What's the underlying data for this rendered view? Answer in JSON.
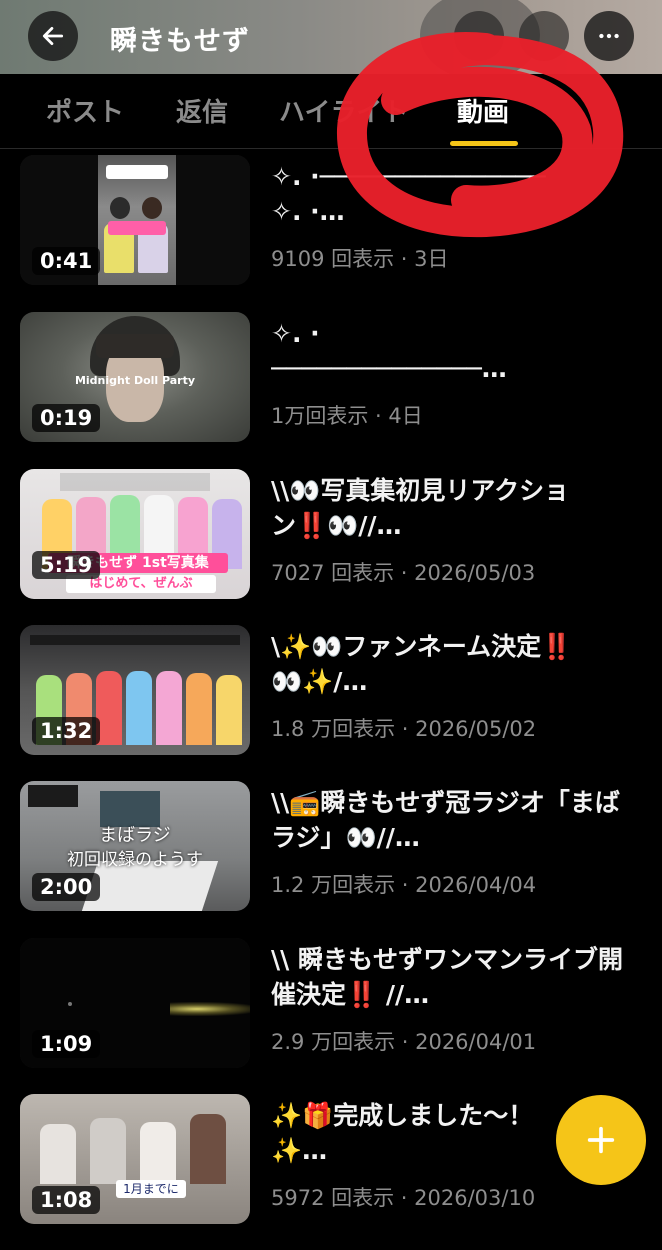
{
  "header": {
    "title": "瞬きもせず",
    "back_icon": "arrow-left-icon",
    "more_icon": "more-horizontal-icon"
  },
  "tabs": [
    {
      "label": "ポスト",
      "active": false
    },
    {
      "label": "返信",
      "active": false
    },
    {
      "label": "ハイライト",
      "active": false
    },
    {
      "label": "動画",
      "active": true
    }
  ],
  "colors": {
    "accent": "#f5c518",
    "annotation": "#e8202a",
    "background": "#000000"
  },
  "videos": [
    {
      "duration": "0:41",
      "title_line1": "✧. ·───────────────",
      "title_line2": "✧. ·…",
      "meta": "9109 回表示 · 3日",
      "thumb_caption": "",
      "thumb_subcaption": ""
    },
    {
      "duration": "0:19",
      "title_line1": "✧. ·",
      "title_line2": "──────────────…",
      "meta": "1万回表示 · 4日",
      "thumb_caption": "Midnight Doll Party",
      "thumb_subcaption": ""
    },
    {
      "duration": "5:19",
      "title_line1": "\\\\👀写真集初見リアクショ",
      "title_line2": "ン‼️👀//…",
      "meta": "7027 回表示 · 2026/05/03",
      "thumb_caption": "瞬きもせず 1st写真集",
      "thumb_subcaption": "はじめて、ぜんぶ"
    },
    {
      "duration": "1:32",
      "title_line1": "\\✨👀ファンネーム決定‼️",
      "title_line2": "👀✨/…",
      "meta": "1.8 万回表示 · 2026/05/02",
      "thumb_caption": "",
      "thumb_subcaption": ""
    },
    {
      "duration": "2:00",
      "title_line1": "\\\\📻瞬きもせず冠ラジオ「まば",
      "title_line2": "ラジ」👀//…",
      "meta": "1.2 万回表示 · 2026/04/04",
      "thumb_caption": "まばラジ",
      "thumb_subcaption": "初回収録のようす"
    },
    {
      "duration": "1:09",
      "title_line1": "\\\\ 瞬きもせずワンマンライブ開",
      "title_line2": "催決定‼️ //…",
      "meta": "2.9 万回表示 · 2026/04/01",
      "thumb_caption": "",
      "thumb_subcaption": ""
    },
    {
      "duration": "1:08",
      "title_line1": "✨🎁完成しました〜！",
      "title_line2": "✨…",
      "meta": "5972 回表示 · 2026/03/10",
      "thumb_caption": "1月までに",
      "thumb_subcaption": ""
    }
  ],
  "fab": {
    "icon": "plus-icon"
  }
}
